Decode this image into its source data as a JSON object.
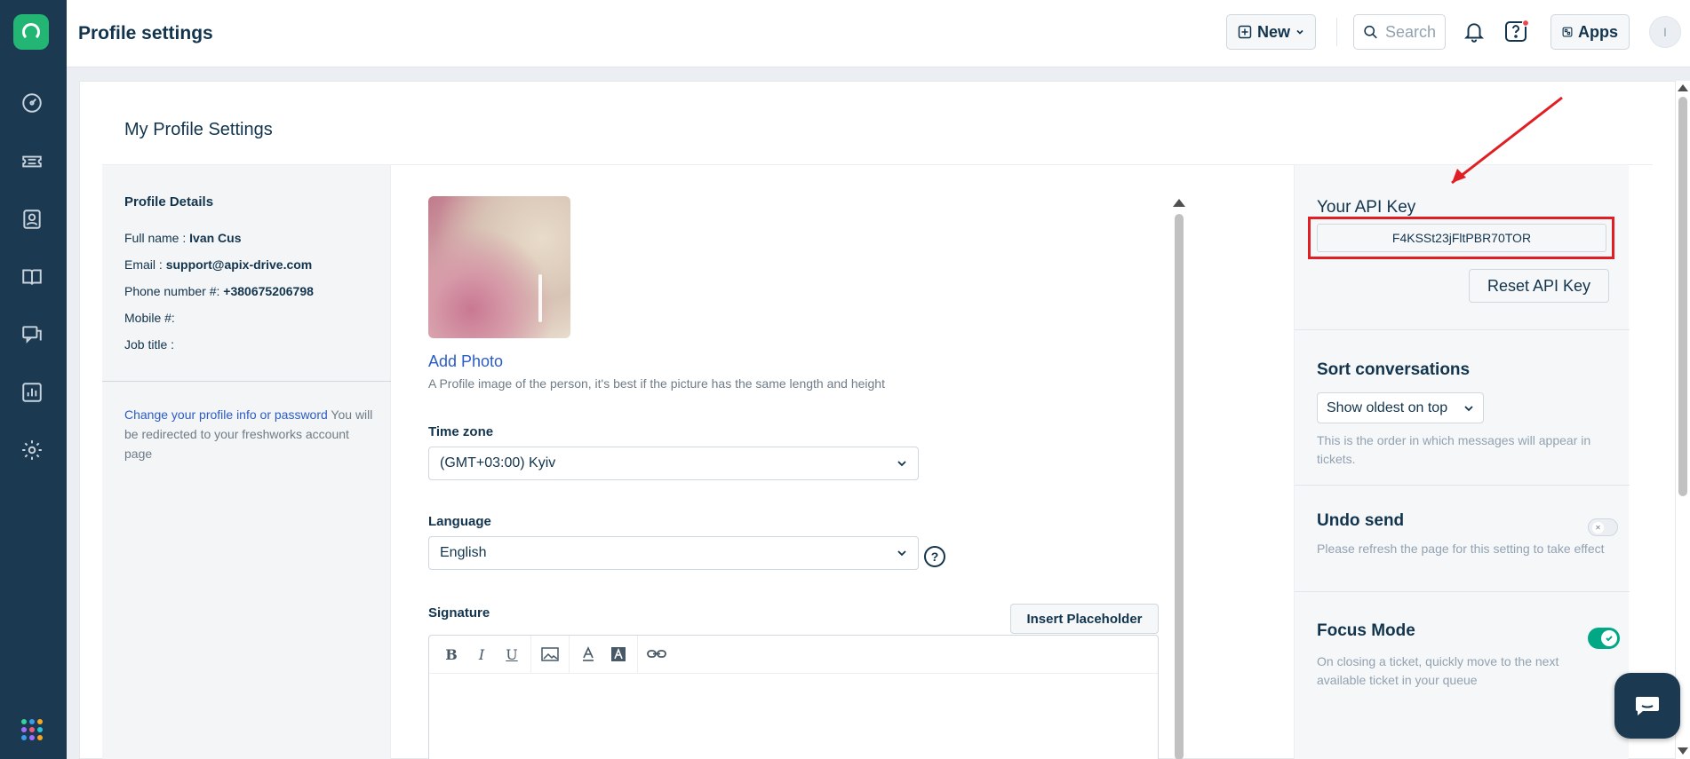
{
  "header": {
    "title": "Profile settings",
    "new_label": "New",
    "search_placeholder": "Search",
    "apps_label": "Apps",
    "avatar_initial": "I"
  },
  "card": {
    "title": "My Profile Settings"
  },
  "profile": {
    "heading": "Profile Details",
    "full_name_label": "Full name :",
    "full_name": "Ivan Cus",
    "email_label": "Email :",
    "email": "support@apix-drive.com",
    "phone_label": "Phone number #:",
    "phone": "+380675206798",
    "mobile_label": "Mobile #:",
    "job_label": "Job title :",
    "change_link": "Change your profile info or password",
    "change_note": " You will be redirected to your freshworks account page"
  },
  "photo": {
    "add_label": "Add Photo",
    "hint": "A Profile image of the person, it's best if the picture has the same length and height"
  },
  "form": {
    "timezone_label": "Time zone",
    "timezone_value": "(GMT+03:00) Kyiv",
    "language_label": "Language",
    "language_value": "English",
    "signature_label": "Signature",
    "insert_placeholder": "Insert Placeholder"
  },
  "editor_tools": [
    "B",
    "I",
    "U"
  ],
  "api": {
    "label": "Your API Key",
    "key": "F4KSSt23jFltPBR70TOR",
    "reset_label": "Reset API Key"
  },
  "settings": {
    "sort_heading": "Sort conversations",
    "sort_value": "Show oldest on top",
    "sort_desc": "This is the order in which messages will appear in tickets.",
    "undo_heading": "Undo send",
    "undo_desc": "Please refresh the page for this setting to take effect",
    "undo_enabled": false,
    "focus_heading": "Focus Mode",
    "focus_desc": "On closing a ticket, quickly move to the next available ticket in your queue",
    "focus_enabled": true
  },
  "colors": {
    "sidebar": "#1b3a52",
    "brand_green": "#22b573",
    "link": "#2c5cc5",
    "highlight_red": "#e01f25",
    "toggle_on": "#00a886"
  },
  "icons": {
    "sidebar": [
      "dashboard-icon",
      "tickets-icon",
      "contacts-icon",
      "solutions-icon",
      "forums-icon",
      "analytics-icon",
      "admin-gear-icon"
    ]
  }
}
